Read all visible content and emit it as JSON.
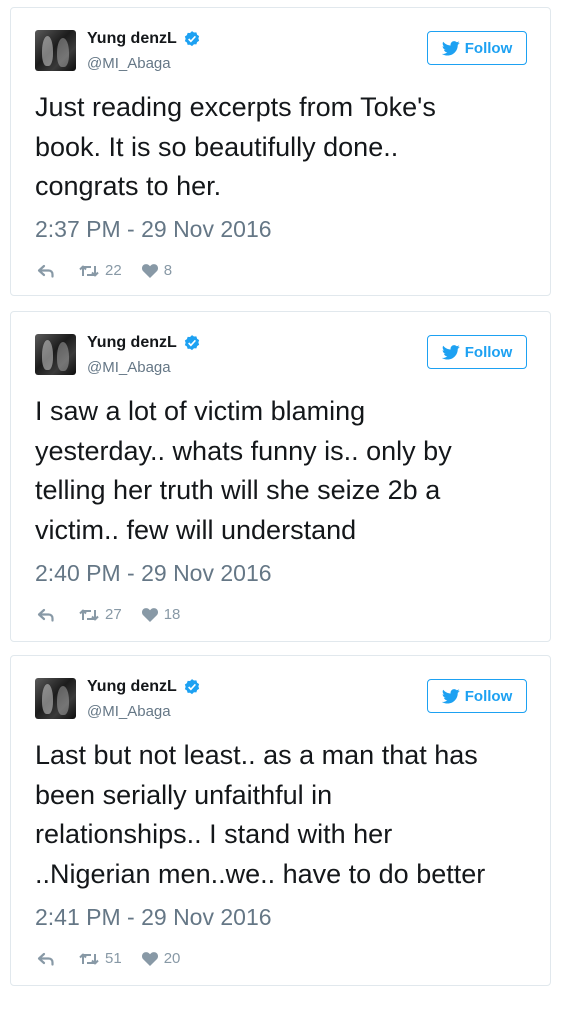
{
  "tweets": [
    {
      "name": "Yung denzL",
      "handle": "@MI_Abaga",
      "follow_label": "Follow",
      "text": "Just reading excerpts from Toke's\nbook. It is so beautifully done..\ncongrats to her.",
      "timestamp": "2:37 PM - 29 Nov 2016",
      "retweets": "22",
      "likes": "8"
    },
    {
      "name": "Yung denzL",
      "handle": "@MI_Abaga",
      "follow_label": "Follow",
      "text": "I saw a lot of victim blaming\nyesterday.. whats funny is.. only by\ntelling her truth will she seize 2b a\nvictim.. few will understand",
      "timestamp": "2:40 PM - 29 Nov 2016",
      "retweets": "27",
      "likes": "18"
    },
    {
      "name": "Yung denzL",
      "handle": "@MI_Abaga",
      "follow_label": "Follow",
      "text": "Last but not least.. as a man that has\nbeen serially unfaithful in\nrelationships.. I stand with her\n..Nigerian men..we.. have to do better",
      "timestamp": "2:41 PM - 29 Nov 2016",
      "retweets": "51",
      "likes": "20"
    }
  ],
  "colors": {
    "brand_blue": "#1da1f2",
    "muted_text": "#657786",
    "action_gray": "#8899a6",
    "border": "#e1e8ed"
  },
  "icons": [
    "verified-badge-icon",
    "twitter-bird-icon",
    "reply-icon",
    "retweet-icon",
    "heart-icon"
  ]
}
